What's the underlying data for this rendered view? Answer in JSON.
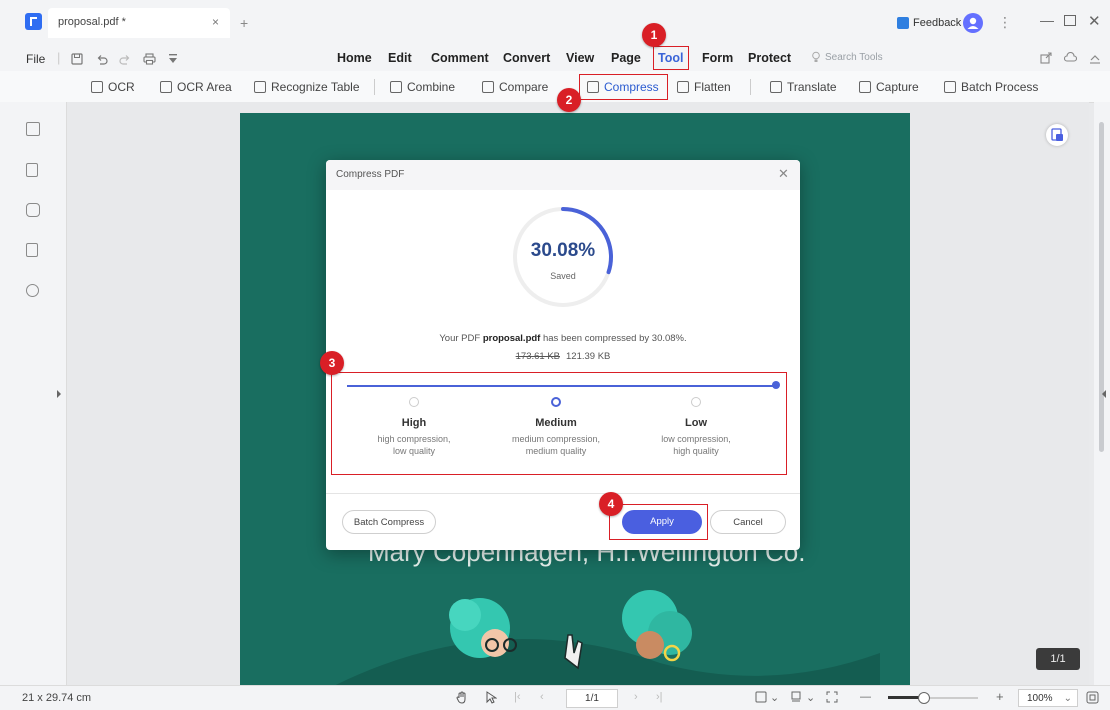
{
  "titlebar": {
    "tab_title": "proposal.pdf *",
    "tab_close": "×",
    "new_tab": "+",
    "feedback": "Feedback",
    "more": "⋮",
    "minimize": "—",
    "close": "✕"
  },
  "menubar": {
    "file": "File",
    "items": [
      "Home",
      "Edit",
      "Comment",
      "Convert",
      "View",
      "Page",
      "Tool",
      "Form",
      "Protect"
    ],
    "active": "Tool",
    "search_placeholder": "Search Tools"
  },
  "ribbon": {
    "items": [
      "OCR",
      "OCR Area",
      "Recognize Table",
      "Combine",
      "Compare",
      "Compress",
      "Flatten",
      "Translate",
      "Capture",
      "Batch Process"
    ]
  },
  "document": {
    "author_line": "Mary Copenhagen, H.I.Wellington Co.",
    "page_indicator": "1/1"
  },
  "dialog": {
    "title": "Compress PDF",
    "close": "✕",
    "percent": "30.08%",
    "percent_value": 30.08,
    "saved_label": "Saved",
    "result_prefix": "Your PDF",
    "file_name": "proposal.pdf",
    "result_mid": "has been compressed by",
    "result_percent": "30.08%.",
    "old_size": "173.61 KB",
    "new_size": "121.39 KB",
    "options": [
      {
        "name": "High",
        "desc1": "high compression,",
        "desc2": "low quality"
      },
      {
        "name": "Medium",
        "desc1": "medium compression,",
        "desc2": "medium quality"
      },
      {
        "name": "Low",
        "desc1": "low compression,",
        "desc2": "high quality"
      }
    ],
    "selected_option": "Medium",
    "batch_compress": "Batch Compress",
    "apply": "Apply",
    "cancel": "Cancel"
  },
  "statusbar": {
    "page_size": "21 x 29.74 cm",
    "page_input": "1/1",
    "zoom": "100%",
    "zoom_minus": "—",
    "zoom_plus": "+"
  },
  "annotations": {
    "badges": [
      "1",
      "2",
      "3",
      "4"
    ],
    "color": "#d91f26"
  },
  "colors": {
    "accent": "#4a5fe0",
    "page_green": "#196e60"
  }
}
